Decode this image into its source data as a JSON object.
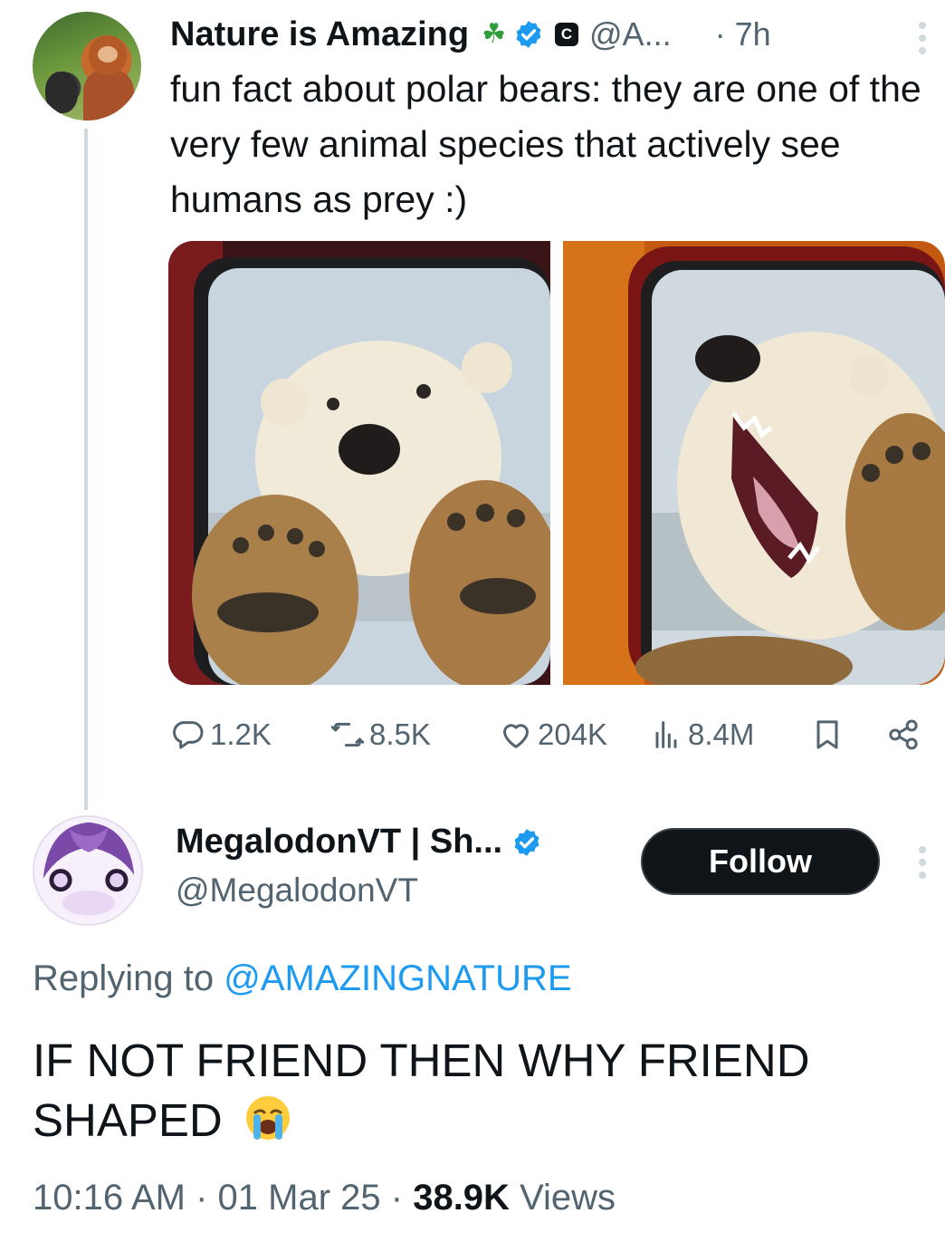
{
  "parent_tweet": {
    "display_name": "Nature is Amazing",
    "handle": "@A...",
    "time": "7h",
    "text": "fun fact about polar bears: they are one of the very few animal species that actively see humans as prey :)",
    "badge_letter": "C",
    "icons": [
      "clover-icon",
      "verified-icon",
      "c-badge-icon",
      "more-icon"
    ],
    "stats": {
      "replies": "1.2K",
      "reposts": "8.5K",
      "likes": "204K",
      "views": "8.4M"
    }
  },
  "reply_tweet": {
    "display_name": "MegalodonVT | Sh...",
    "handle": "@MegalodonVT",
    "follow_label": "Follow",
    "replying_prefix": "Replying to",
    "replying_to": "@AMAZINGNATURE",
    "text": "IF NOT FRIEND THEN WHY FRIEND SHAPED",
    "timestamp": "10:16 AM · 01 Mar 25 · ",
    "views_count": "38.9K",
    "views_label": " Views"
  },
  "colors": {
    "text_primary": "#0f1419",
    "text_secondary": "#536471",
    "verified_blue": "#1d9bf0",
    "thread_line": "#cfd9de",
    "button_dark": "#0f1419"
  }
}
